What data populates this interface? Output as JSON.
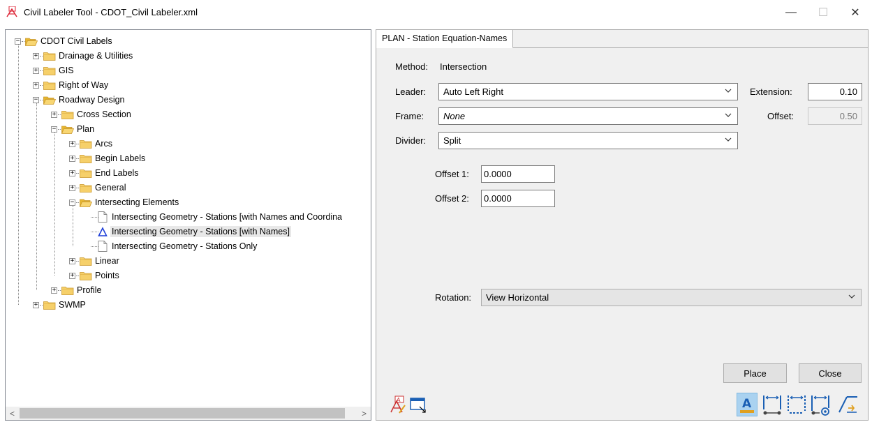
{
  "window": {
    "title": "Civil Labeler Tool - CDOT_Civil Labeler.xml",
    "minimize": "—",
    "maximize": "☐",
    "close": "✕"
  },
  "tree": {
    "root": "CDOT Civil Labels",
    "items": [
      {
        "label": "Drainage & Utilities"
      },
      {
        "label": "GIS"
      },
      {
        "label": "Right of Way"
      },
      {
        "label": "Roadway Design"
      },
      {
        "label": "Cross Section"
      },
      {
        "label": "Plan"
      },
      {
        "label": "Arcs"
      },
      {
        "label": "Begin Labels"
      },
      {
        "label": "End Labels"
      },
      {
        "label": "General"
      },
      {
        "label": "Intersecting Elements"
      },
      {
        "label": "Intersecting Geometry - Stations [with Names and Coordina"
      },
      {
        "label": "Intersecting Geometry - Stations [with Names]"
      },
      {
        "label": "Intersecting Geometry - Stations Only"
      },
      {
        "label": "Linear"
      },
      {
        "label": "Points"
      },
      {
        "label": "Profile"
      },
      {
        "label": "SWMP"
      }
    ],
    "scroll_left": "<",
    "scroll_right": ">"
  },
  "panel": {
    "tab_label": "PLAN - Station Equation-Names",
    "method_label": "Method:",
    "method_value": "Intersection",
    "leader_label": "Leader:",
    "leader_value": "Auto Left Right",
    "frame_label": "Frame:",
    "frame_value": "None",
    "divider_label": "Divider:",
    "divider_value": "Split",
    "extension_label": "Extension:",
    "extension_value": "0.10",
    "offset_label": "Offset:",
    "offset_value": "0.50",
    "offset1_label": "Offset 1:",
    "offset1_value": "0.0000",
    "offset2_label": "Offset 2:",
    "offset2_value": "0.0000",
    "rotation_label": "Rotation:",
    "rotation_value": "View Horizontal",
    "place_button": "Place",
    "close_button": "Close"
  },
  "colors": {
    "folder": "#f2c94c",
    "selected_icon": "#1e3fd8",
    "tool_highlight": "#aad2f0",
    "tool_blue": "#1a5fb4"
  }
}
